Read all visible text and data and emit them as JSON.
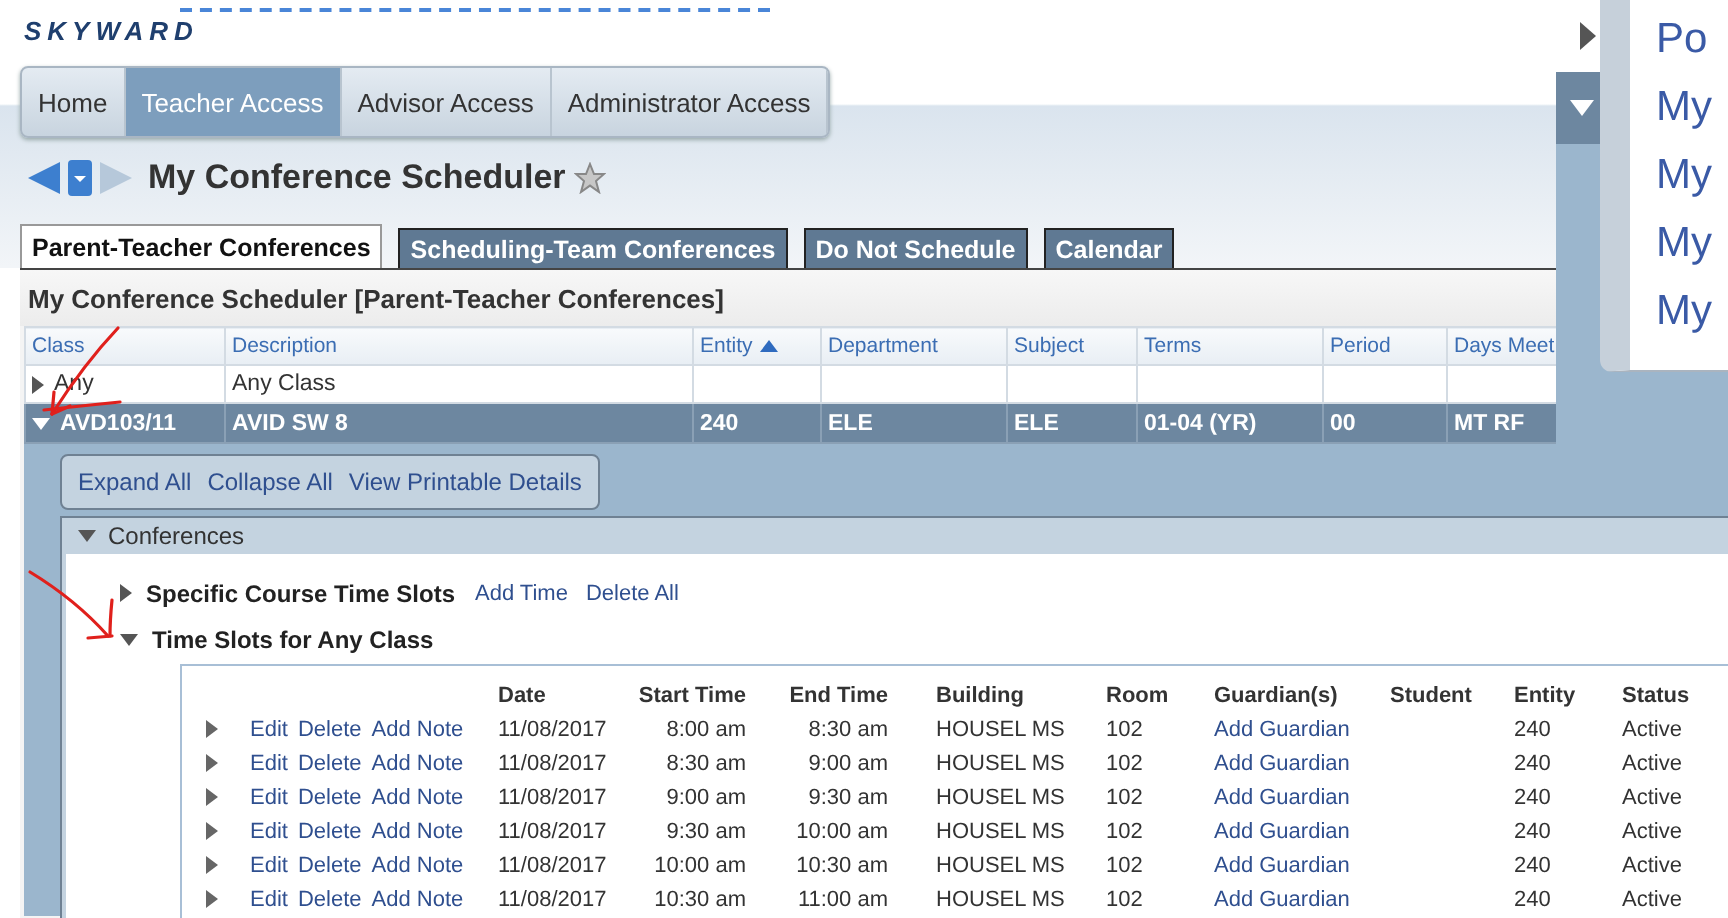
{
  "logo": "SKYWARD",
  "nav_tabs": [
    {
      "label": "Home",
      "selected": false
    },
    {
      "label": "Teacher Access",
      "selected": true
    },
    {
      "label": "Advisor Access",
      "selected": false
    },
    {
      "label": "Administrator Access",
      "selected": false
    }
  ],
  "page_title": "My Conference Scheduler",
  "tabs": [
    {
      "label": "Parent-Teacher Conferences",
      "selected": true
    },
    {
      "label": "Scheduling-Team Conferences",
      "selected": false
    },
    {
      "label": "Do Not Schedule",
      "selected": false
    },
    {
      "label": "Calendar",
      "selected": false
    }
  ],
  "panel_title": "My Conference Scheduler [Parent-Teacher Conferences]",
  "classes_table": {
    "columns": [
      {
        "label": "Class",
        "sorted": false
      },
      {
        "label": "Description",
        "sorted": false
      },
      {
        "label": "Entity",
        "sorted": true
      },
      {
        "label": "Department",
        "sorted": false
      },
      {
        "label": "Subject",
        "sorted": false
      },
      {
        "label": "Terms",
        "sorted": false
      },
      {
        "label": "Period",
        "sorted": false
      },
      {
        "label": "Days Meet",
        "sorted": false
      }
    ],
    "rows": [
      {
        "expanded": false,
        "selected": false,
        "class": "Any",
        "description": "Any Class"
      },
      {
        "expanded": true,
        "selected": true,
        "class": "AVD103/11",
        "description": "AVID SW 8",
        "entity": "240",
        "department": "ELE",
        "subject": "ELE",
        "terms": "01-04 (YR)",
        "period": "00",
        "days_meet": "MT RF"
      }
    ]
  },
  "detail_actions": [
    "Expand All",
    "Collapse All",
    "View Printable Details"
  ],
  "conferences": {
    "title": "Conferences",
    "expanded": true,
    "sections": [
      {
        "title": "Specific Course Time Slots",
        "expanded": false,
        "actions": [
          "Add Time",
          "Delete All"
        ]
      },
      {
        "title": "Time Slots for Any Class",
        "expanded": true
      }
    ],
    "slots_table": {
      "columns": [
        "Date",
        "Start Time",
        "End Time",
        "Building",
        "Room",
        "Guardian(s)",
        "Student",
        "Entity",
        "Status"
      ],
      "rows": [
        {
          "expanded": false,
          "actions": [
            "Edit",
            "Delete",
            "Add Note"
          ],
          "date": "11/08/2017",
          "start": "8:00 am",
          "end": "8:30 am",
          "building": "HOUSEL MS",
          "room": "102",
          "guardian": "Add Guardian",
          "entity": "240",
          "status": "Active"
        },
        {
          "expanded": false,
          "actions": [
            "Edit",
            "Delete",
            "Add Note"
          ],
          "date": "11/08/2017",
          "start": "8:30 am",
          "end": "9:00 am",
          "building": "HOUSEL MS",
          "room": "102",
          "guardian": "Add Guardian",
          "entity": "240",
          "status": "Active"
        },
        {
          "expanded": false,
          "actions": [
            "Edit",
            "Delete",
            "Add Note"
          ],
          "date": "11/08/2017",
          "start": "9:00 am",
          "end": "9:30 am",
          "building": "HOUSEL MS",
          "room": "102",
          "guardian": "Add Guardian",
          "entity": "240",
          "status": "Active"
        },
        {
          "expanded": false,
          "actions": [
            "Edit",
            "Delete",
            "Add Note"
          ],
          "date": "11/08/2017",
          "start": "9:30 am",
          "end": "10:00 am",
          "building": "HOUSEL MS",
          "room": "102",
          "guardian": "Add Guardian",
          "entity": "240",
          "status": "Active"
        },
        {
          "expanded": false,
          "actions": [
            "Edit",
            "Delete",
            "Add Note"
          ],
          "date": "11/08/2017",
          "start": "10:00 am",
          "end": "10:30 am",
          "building": "HOUSEL MS",
          "room": "102",
          "guardian": "Add Guardian",
          "entity": "240",
          "status": "Active"
        },
        {
          "expanded": false,
          "actions": [
            "Edit",
            "Delete",
            "Add Note"
          ],
          "date": "11/08/2017",
          "start": "10:30 am",
          "end": "11:00 am",
          "building": "HOUSEL MS",
          "room": "102",
          "guardian": "Add Guardian",
          "entity": "240",
          "status": "Active"
        }
      ]
    }
  },
  "popup_menu": {
    "items": [
      "Po",
      "My",
      "My",
      "My",
      "My"
    ]
  }
}
